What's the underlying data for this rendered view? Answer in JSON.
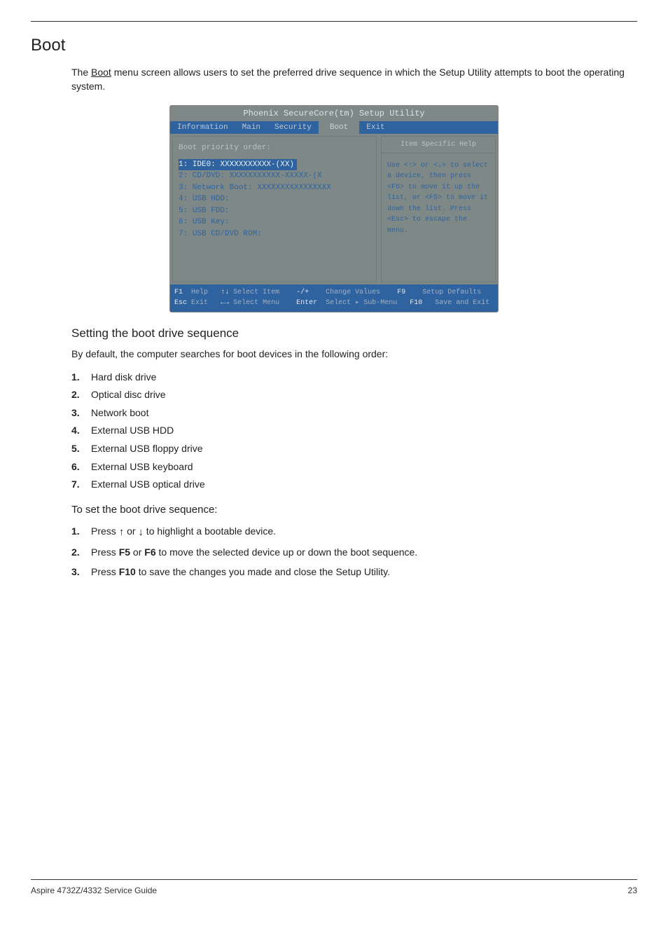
{
  "section_title": "Boot",
  "intro_pre": "The ",
  "intro_u": "Boot",
  "intro_post": " menu screen allows users to set the preferred drive sequence in which the Setup Utility attempts to boot the operating system.",
  "bios": {
    "title": "Phoenix SecureCore(tm) Setup Utility",
    "tabs": [
      "Information",
      "Main",
      "Security",
      "Boot",
      "Exit"
    ],
    "active_tab": "Boot",
    "priority_label": "Boot priority order:",
    "items": [
      "1: IDE0: XXXXXXXXXXX-(XX)",
      "2: CD/DVD: XXXXXXXXXXX-XXXXX-(X",
      "3: Network Boot: XXXXXXXXXXXXXXXX",
      "4: USB HDD:",
      "5: USB FDD:",
      "6: USB Key:",
      "7: USB CD/DVD ROM:"
    ],
    "help_title": "Item Specific Help",
    "help_text": "Use <↑> or <↓> to select a device, then press <F6> to move it up the list, or <F5> to move it down the list. Press <Esc> to escape the menu.",
    "foot1_f1": "F1",
    "foot1_help": "Help",
    "foot1_select_item": "Select Item",
    "foot1_minusplus": "-/+",
    "foot1_change": "Change Values",
    "foot1_f9": "F9",
    "foot1_setup": "Setup Defaults",
    "foot2_esc": "Esc",
    "foot2_exit": "Exit",
    "foot2_select_menu": "Select Menu",
    "foot2_enter": "Enter",
    "foot2_select": "Select",
    "foot2_sub": "▸ Sub-Menu",
    "foot2_f10": "F10",
    "foot2_save": "Save and Exit"
  },
  "sub_heading": "Setting the boot drive sequence",
  "default_para": "By default, the computer searches for boot devices in the following order:",
  "boot_order": [
    "Hard disk drive",
    "Optical disc drive",
    "Network boot",
    "External USB HDD",
    "External USB floppy drive",
    "External USB keyboard",
    "External USB optical drive"
  ],
  "steps_heading": "To set the boot drive sequence:",
  "step1_pre": "Press ",
  "step1_mid": " or ",
  "step1_post": " to highlight a bootable device.",
  "step2_pre": "Press ",
  "step2_f5": "F5",
  "step2_mid": " or ",
  "step2_f6": "F6",
  "step2_post": " to move the selected device up or down the boot sequence.",
  "step3_pre": "Press ",
  "step3_f10": "F10",
  "step3_post": " to save the changes you made and close the Setup Utility.",
  "footer_left": "Aspire 4732Z/4332 Service Guide",
  "footer_right": "23"
}
